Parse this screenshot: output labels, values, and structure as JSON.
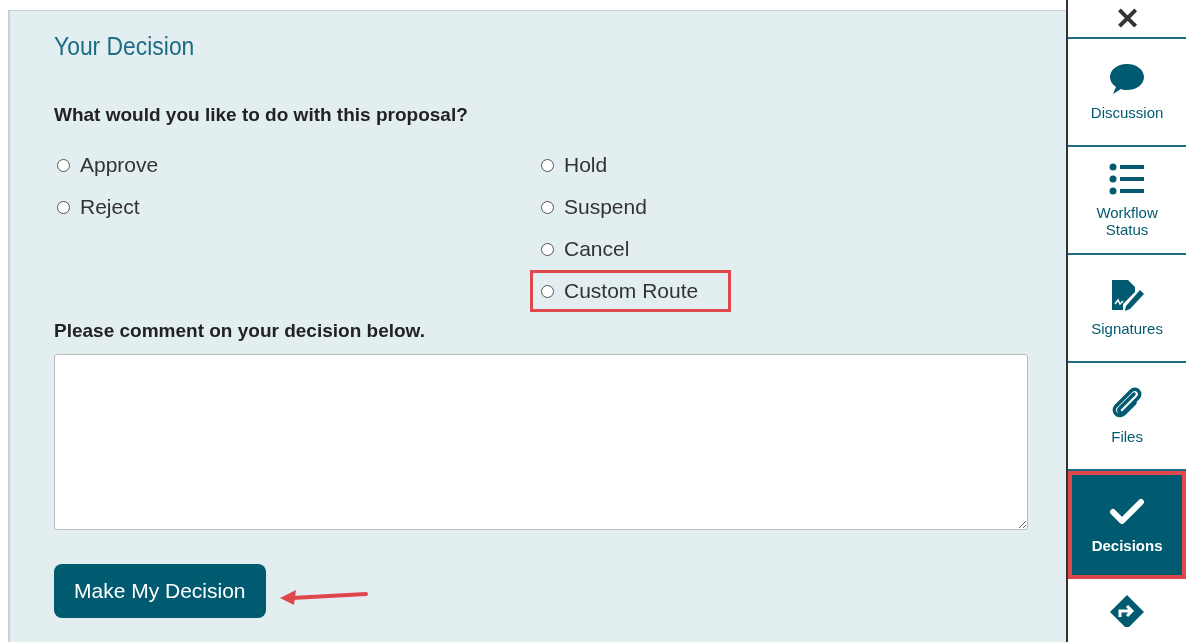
{
  "panel": {
    "title": "Your Decision",
    "question": "What would you like to do with this proposal?",
    "option_columns": [
      [
        {
          "label": "Approve",
          "selected": false,
          "highlighted": false
        },
        {
          "label": "Reject",
          "selected": false,
          "highlighted": false
        }
      ],
      [
        {
          "label": "Hold",
          "selected": false,
          "highlighted": false
        },
        {
          "label": "Suspend",
          "selected": false,
          "highlighted": false
        },
        {
          "label": "Cancel",
          "selected": false,
          "highlighted": false
        },
        {
          "label": "Custom Route",
          "selected": false,
          "highlighted": true
        }
      ]
    ],
    "comment_label": "Please comment on your decision below.",
    "submit_button": "Make My Decision"
  },
  "sidebar": {
    "close": "✕",
    "tabs": [
      {
        "kind": "discussion",
        "label": "Discussion",
        "selected": false,
        "highlighted": false
      },
      {
        "kind": "workflow",
        "label": "Workflow Status",
        "selected": false,
        "highlighted": false
      },
      {
        "kind": "signatures",
        "label": "Signatures",
        "selected": false,
        "highlighted": false
      },
      {
        "kind": "files",
        "label": "Files",
        "selected": false,
        "highlighted": false
      },
      {
        "kind": "decisions",
        "label": "Decisions",
        "selected": true,
        "highlighted": true
      },
      {
        "kind": "route",
        "selected": false,
        "highlighted": false
      }
    ]
  }
}
